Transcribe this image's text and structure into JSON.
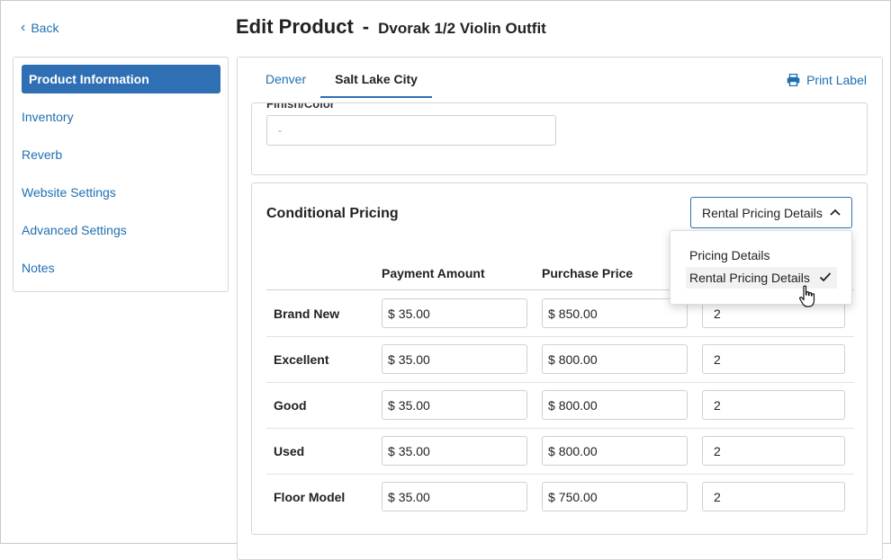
{
  "nav": {
    "back_label": "Back"
  },
  "header": {
    "title": "Edit Product",
    "separator": "-",
    "product_name": "Dvorak 1/2 Violin Outfit"
  },
  "sidebar": {
    "items": [
      {
        "label": "Product Information"
      },
      {
        "label": "Inventory"
      },
      {
        "label": "Reverb"
      },
      {
        "label": "Website Settings"
      },
      {
        "label": "Advanced Settings"
      },
      {
        "label": "Notes"
      }
    ]
  },
  "tabs": [
    {
      "label": "Denver"
    },
    {
      "label": "Salt Lake City"
    }
  ],
  "print_label": "Print Label",
  "finish": {
    "label": "Finish/Color",
    "value": "-"
  },
  "conditional_pricing": {
    "title": "Conditional Pricing",
    "selected": "Rental Pricing Details",
    "options": [
      "Pricing Details",
      "Rental Pricing Details"
    ],
    "columns": [
      "Payment Amount",
      "Purchase Price"
    ],
    "currency": "$",
    "rows": [
      {
        "condition": "Brand New",
        "payment": "35.00",
        "purchase": "850.00",
        "term": "2"
      },
      {
        "condition": "Excellent",
        "payment": "35.00",
        "purchase": "800.00",
        "term": "2"
      },
      {
        "condition": "Good",
        "payment": "35.00",
        "purchase": "800.00",
        "term": "2"
      },
      {
        "condition": "Used",
        "payment": "35.00",
        "purchase": "800.00",
        "term": "2"
      },
      {
        "condition": "Floor Model",
        "payment": "35.00",
        "purchase": "750.00",
        "term": "2"
      }
    ]
  },
  "colors": {
    "accent": "#2f6fb4",
    "link": "#1f6fb2",
    "border": "#d6d6d6"
  }
}
